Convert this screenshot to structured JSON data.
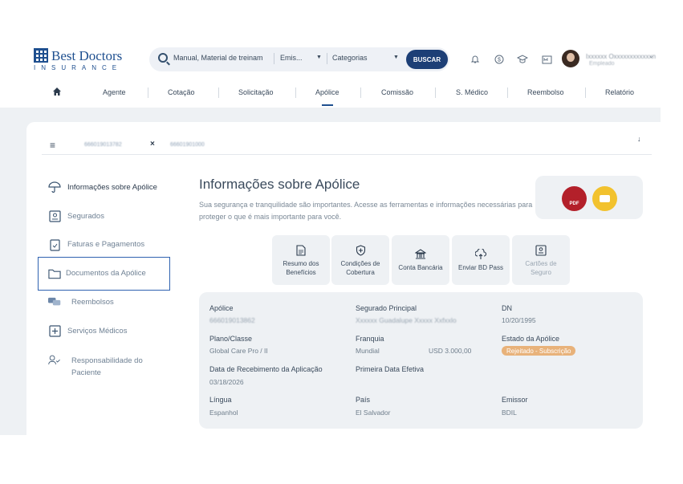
{
  "brand": {
    "name": "Best Doctors",
    "sub": "INSURANCE"
  },
  "search": {
    "value": "Manual, Material de treinam",
    "filter1": "Emis...",
    "filter2": "Categorias",
    "button": "BUSCAR"
  },
  "toolbar_icons": [
    "bell-icon",
    "dollar-icon",
    "graduation-icon",
    "mail-icon"
  ],
  "user": {
    "name": "Ixxxxxx Oxxxxxxxxxxxxn",
    "role": "Empleado"
  },
  "nav": {
    "items": [
      "Agente",
      "Cotação",
      "Solicitação",
      "Apólice",
      "Comissão",
      "S. Médico",
      "Reembolso",
      "Relatório"
    ],
    "active": "Apólice"
  },
  "tabs": {
    "tab1": "666019013782",
    "tab2": "66601901000"
  },
  "sidebar": {
    "items": [
      {
        "label": "Informações sobre Apólice",
        "icon": "umbrella-icon"
      },
      {
        "label": "Segurados",
        "icon": "id-card-icon"
      },
      {
        "label": "Faturas e Pagamentos",
        "icon": "invoice-icon"
      },
      {
        "label": "Documentos da Apólice",
        "icon": "folder-icon"
      },
      {
        "label": "Reembolsos",
        "icon": "chat-icon"
      },
      {
        "label": "Serviços Médicos",
        "icon": "medical-plus-icon"
      },
      {
        "label": "Responsabilidade do Paciente",
        "icon": "user-check-icon"
      }
    ]
  },
  "main": {
    "title": "Informações sobre Apólice",
    "description": "Sua segurança e tranquilidade são importantes. Acesse as ferramentas e informações necessárias para proteger o que é mais importante para você.",
    "pdf_label": "PDF",
    "actions": [
      {
        "label": "Resumo dos\nBenefícios",
        "icon": "document-icon",
        "enabled": true
      },
      {
        "label": "Condições de\nCobertura",
        "icon": "shield-plus-icon",
        "enabled": true
      },
      {
        "label": "Conta Bancária",
        "icon": "bank-icon",
        "enabled": true
      },
      {
        "label": "Enviar BD Pass",
        "icon": "upload-icon",
        "enabled": true
      },
      {
        "label": "Cartões de\nSeguro",
        "icon": "card-icon",
        "enabled": false
      }
    ]
  },
  "policy": {
    "apolice_label": "Apólice",
    "apolice_value": "666019013862",
    "segurado_label": "Segurado Principal",
    "segurado_value": "Xxxxxx Guadalupe Xxxxx Xxfxxlo",
    "dn_label": "DN",
    "dn_value": "10/20/1995",
    "plano_label": "Plano/Classe",
    "plano_value": "Global Care Pro / II",
    "franquia_label": "Franquia",
    "franquia_value": "Mundial",
    "franquia_amount": "USD 3.000,00",
    "estado_label": "Estado da Apólice",
    "estado_value": "Rejeitado - Subscrição",
    "recebimento_label": "Data de Recebimento da Aplicação",
    "recebimento_value": "03/18/2026",
    "primeira_label": "Primeira Data Efetiva",
    "lingua_label": "Língua",
    "lingua_value": "Espanhol",
    "pais_label": "País",
    "pais_value": "El Salvador",
    "emissor_label": "Emissor",
    "emissor_value": "BDIL"
  }
}
